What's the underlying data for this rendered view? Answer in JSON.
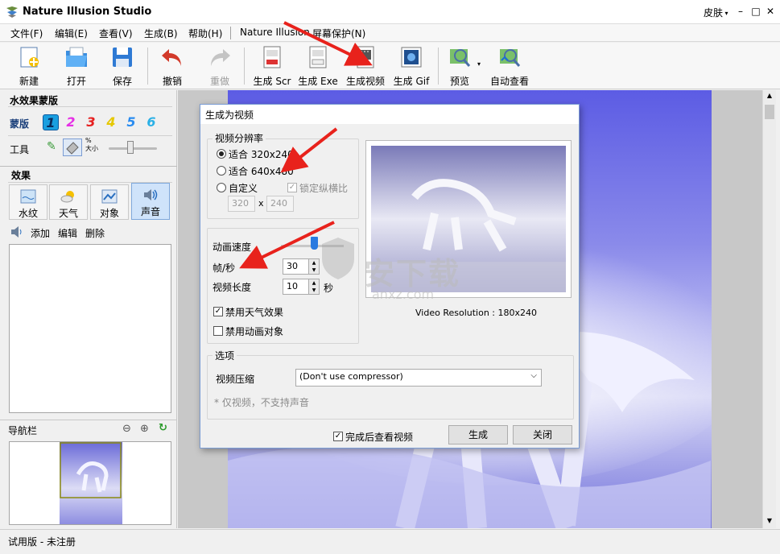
{
  "window": {
    "title": "Nature Illusion Studio",
    "skin_label": "皮肤",
    "minimize": "–",
    "maximize": "□",
    "close": "✕"
  },
  "menu": {
    "items": [
      "文件(F)",
      "编辑(E)",
      "查看(V)",
      "生成(B)",
      "帮助(H)"
    ],
    "extra": [
      "Nature Illusion",
      "屏幕保护(N)"
    ]
  },
  "toolbar": {
    "new": "新建",
    "open": "打开",
    "save": "保存",
    "undo": "撤销",
    "redo": "重做",
    "gen_scr": "生成 Scr",
    "gen_exe": "生成 Exe",
    "gen_video": "生成视频",
    "gen_gif": "生成 Gif",
    "preview": "预览",
    "auto_view": "自动查看"
  },
  "left": {
    "mask_header": "水效果蒙版",
    "mask_label": "蒙版",
    "mask_numbers": [
      "1",
      "2",
      "3",
      "4",
      "5",
      "6"
    ],
    "mask_colors": [
      "#1a9fe0",
      "#e62ee6",
      "#e62020",
      "#e6c800",
      "#2a8cf0",
      "#2ab0e6"
    ],
    "tools_label": "工具",
    "size_label_top": "%",
    "size_label_bottom": "大小",
    "effects_header": "效果",
    "tabs": [
      "水纹",
      "天气",
      "对象",
      "声音"
    ],
    "sound_actions": {
      "add": "添加",
      "edit": "编辑",
      "delete": "删除"
    },
    "nav_header": "导航栏"
  },
  "status": {
    "text": "试用版 - 未注册"
  },
  "dialog": {
    "title": "生成为视频",
    "resolution_group": "视频分辨率",
    "res_options": [
      "适合 320x240",
      "适合 640x480",
      "自定义"
    ],
    "lock_ratio": "锁定纵横比",
    "custom_w": "320",
    "custom_x": "x",
    "custom_h": "240",
    "speed_label": "动画速度",
    "fps_label": "帧/秒",
    "fps_value": "30",
    "length_label": "视频长度",
    "length_value": "10",
    "length_unit": "秒",
    "disable_weather": "禁用天气效果",
    "disable_objects": "禁用动画对象",
    "preview_caption": "Video Resolution : 180x240",
    "options_group": "选项",
    "compress_label": "视频压缩",
    "compress_value": "(Don't use compressor)",
    "note": "* 仅视频，不支持声音",
    "view_after": "完成后查看视频",
    "generate_btn": "生成",
    "close_btn": "关闭"
  },
  "watermark": {
    "text": "安下载",
    "sub": "anxz.com"
  },
  "colors": {
    "accent": "#1a6fd6",
    "annotation_red": "#e8221c",
    "sky_blue": "#5a5ae0"
  }
}
